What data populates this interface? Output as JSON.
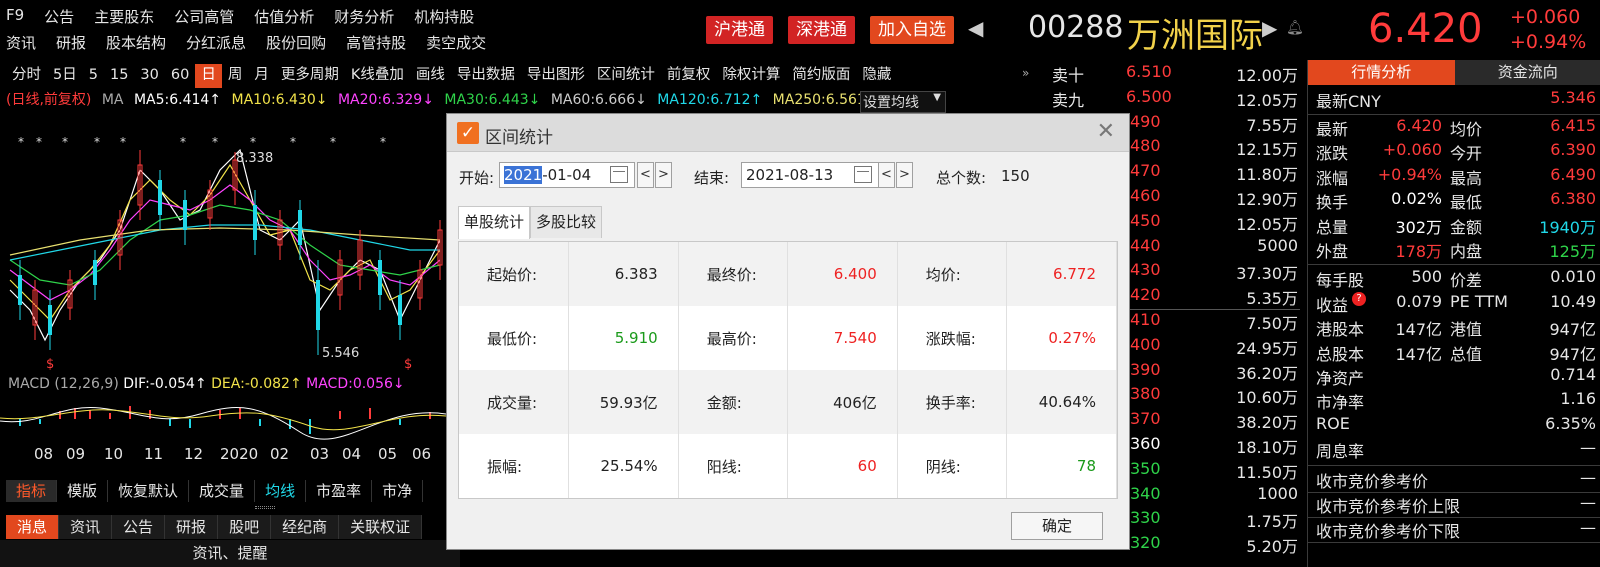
{
  "top_menu": {
    "row1": [
      "F9",
      "公告",
      "主要股东",
      "公司高管",
      "估值分析",
      "财务分析",
      "机构持股"
    ],
    "row2": [
      "资讯",
      "研报",
      "股本结构",
      "分红派息",
      "股份回购",
      "高管持股",
      "卖空成交"
    ]
  },
  "tags": {
    "hk_sh": "沪港通",
    "hk_sz": "深港通",
    "add_watch": "加入自选"
  },
  "stock": {
    "code": "00288",
    "name": "万洲国际",
    "price": "6.420",
    "change": "+0.060",
    "change_pct": "+0.94%"
  },
  "toolbar": [
    "分时",
    "5日",
    "5",
    "15",
    "30",
    "60",
    "日",
    "周",
    "月",
    "更多周期",
    "K线叠加",
    "画线",
    "导出数据",
    "导出图形",
    "区间统计",
    "前复权",
    "除权计算",
    "简约版面",
    "隐藏"
  ],
  "toolbar_selected": "日",
  "ma_legend": {
    "prefix": "(日线,前复权)",
    "ma": "MA",
    "ma5": "MA5:6.414↑",
    "ma10": "MA10:6.430↓",
    "ma20": "MA20:6.329↓",
    "ma30": "MA30:6.443↓",
    "ma60": "MA60:6.666↓",
    "ma120": "MA120:6.712↑",
    "ma250": "MA250:6.561",
    "settings": "设置均线"
  },
  "chart": {
    "high_label": "8.338",
    "low_label": "5.546",
    "macd_title": "MACD (12,26,9)",
    "dif": "DIF:-0.054↑",
    "dea": "DEA:-0.082↑",
    "macd": "MACD:0.056↓",
    "x_axis": [
      "08",
      "09",
      "10",
      "11",
      "12",
      "2020",
      "02",
      "03",
      "04",
      "05",
      "06"
    ],
    "dollar_mark": "$",
    "star_mark": "*"
  },
  "bottom_tabs1": [
    "指标",
    "模版",
    "恢复默认",
    "成交量",
    "均线",
    "市盈率",
    "市净"
  ],
  "bottom_tabs1_selected": "指标",
  "bottom_tabs2": [
    "消息",
    "资讯",
    "公告",
    "研报",
    "股吧",
    "经纪商",
    "关联权证"
  ],
  "bottom_tabs2_selected": "消息",
  "remind": "资讯、提醒",
  "order_book": [
    {
      "label": "卖十",
      "price": "6.510",
      "vol": "12.00万",
      "c": "red"
    },
    {
      "label": "卖九",
      "price": "6.500",
      "vol": "12.05万",
      "c": "red"
    },
    {
      "label": "",
      "price": "490",
      "vol": "7.55万",
      "c": "red"
    },
    {
      "label": "",
      "price": "480",
      "vol": "12.15万",
      "c": "red"
    },
    {
      "label": "",
      "price": "470",
      "vol": "11.80万",
      "c": "red"
    },
    {
      "label": "",
      "price": "460",
      "vol": "12.90万",
      "c": "red"
    },
    {
      "label": "",
      "price": "450",
      "vol": "12.05万",
      "c": "red"
    },
    {
      "label": "",
      "price": "440",
      "vol": "5000",
      "c": "red"
    },
    {
      "label": "",
      "price": "430",
      "vol": "37.30万",
      "c": "red"
    },
    {
      "label": "",
      "price": "420",
      "vol": "5.35万",
      "c": "red"
    },
    {
      "label": "",
      "price": "410",
      "vol": "7.50万",
      "c": "red"
    },
    {
      "label": "",
      "price": "400",
      "vol": "24.95万",
      "c": "red"
    },
    {
      "label": "",
      "price": "390",
      "vol": "36.20万",
      "c": "red"
    },
    {
      "label": "",
      "price": "380",
      "vol": "10.60万",
      "c": "red"
    },
    {
      "label": "",
      "price": "370",
      "vol": "38.20万",
      "c": "red"
    },
    {
      "label": "",
      "price": "360",
      "vol": "18.10万",
      "c": "white"
    },
    {
      "label": "",
      "price": "350",
      "vol": "11.50万",
      "c": "green"
    },
    {
      "label": "",
      "price": "340",
      "vol": "1000",
      "c": "green"
    },
    {
      "label": "",
      "price": "330",
      "vol": "1.75万",
      "c": "green"
    },
    {
      "label": "",
      "price": "320",
      "vol": "5.20万",
      "c": "green"
    }
  ],
  "right_panel": {
    "tabs": [
      "行情分析",
      "资金流向"
    ],
    "cny_label": "最新CNY",
    "cny_value": "5.346",
    "quote_rows": [
      {
        "k1": "最新",
        "v1": "6.420",
        "c1": "red",
        "k2": "均价",
        "v2": "6.415",
        "c2": "red"
      },
      {
        "k1": "涨跌",
        "v1": "+0.060",
        "c1": "red",
        "k2": "今开",
        "v2": "6.390",
        "c2": "red"
      },
      {
        "k1": "涨幅",
        "v1": "+0.94%",
        "c1": "red",
        "k2": "最高",
        "v2": "6.490",
        "c2": "red"
      },
      {
        "k1": "换手",
        "v1": "0.02%",
        "c1": "white",
        "k2": "最低",
        "v2": "6.380",
        "c2": "red"
      },
      {
        "k1": "总量",
        "v1": "302万",
        "c1": "white",
        "k2": "金额",
        "v2": "1940万",
        "c2": "cyan"
      },
      {
        "k1": "外盘",
        "v1": "178万",
        "c1": "red",
        "k2": "内盘",
        "v2": "125万",
        "c2": "green"
      }
    ],
    "info_rows": [
      {
        "k1": "每手股",
        "v1": "500",
        "k2": "价差",
        "v2": "0.010"
      },
      {
        "k1": "收益",
        "v1": "0.079",
        "k2": "PE TTM",
        "v2": "10.49"
      },
      {
        "k1": "港股本",
        "v1": "147亿",
        "k2": "港值",
        "v2": "947亿"
      },
      {
        "k1": "总股本",
        "v1": "147亿",
        "k2": "总值",
        "v2": "947亿"
      }
    ],
    "single_rows": [
      {
        "k": "净资产",
        "v": "0.714"
      },
      {
        "k": "市净率",
        "v": "1.16"
      },
      {
        "k": "ROE",
        "v": "6.35%"
      },
      {
        "k": "周息率",
        "v": "—"
      }
    ],
    "auction_rows": [
      {
        "k": "收市竞价参考价",
        "v": "—"
      },
      {
        "k": "收市竞价参考价上限",
        "v": "—"
      },
      {
        "k": "收市竞价参考价下限",
        "v": "—"
      }
    ]
  },
  "dialog": {
    "title": "区间统计",
    "start_label": "开始:",
    "start_year": "2021",
    "start_rest": "-01-04",
    "end_label": "结束:",
    "end_value": "2021-08-13",
    "count_label": "总个数:",
    "count_value": "150",
    "tabs": [
      "单股统计",
      "多股比较"
    ],
    "rows": [
      [
        {
          "l": "起始价:",
          "v": "6.383",
          "c": "black"
        },
        {
          "l": "最终价:",
          "v": "6.400",
          "c": "red"
        },
        {
          "l": "均价:",
          "v": "6.772",
          "c": "red"
        }
      ],
      [
        {
          "l": "最低价:",
          "v": "5.910",
          "c": "green"
        },
        {
          "l": "最高价:",
          "v": "7.540",
          "c": "red"
        },
        {
          "l": "涨跌幅:",
          "v": "0.27%",
          "c": "red"
        }
      ],
      [
        {
          "l": "成交量:",
          "v": "59.93亿",
          "c": "black"
        },
        {
          "l": "金额:",
          "v": "406亿",
          "c": "black"
        },
        {
          "l": "换手率:",
          "v": "40.64%",
          "c": "black"
        }
      ],
      [
        {
          "l": "振幅:",
          "v": "25.54%",
          "c": "black"
        },
        {
          "l": "阳线:",
          "v": "60",
          "c": "red"
        },
        {
          "l": "阴线:",
          "v": "78",
          "c": "green"
        }
      ]
    ],
    "ok": "确定"
  }
}
